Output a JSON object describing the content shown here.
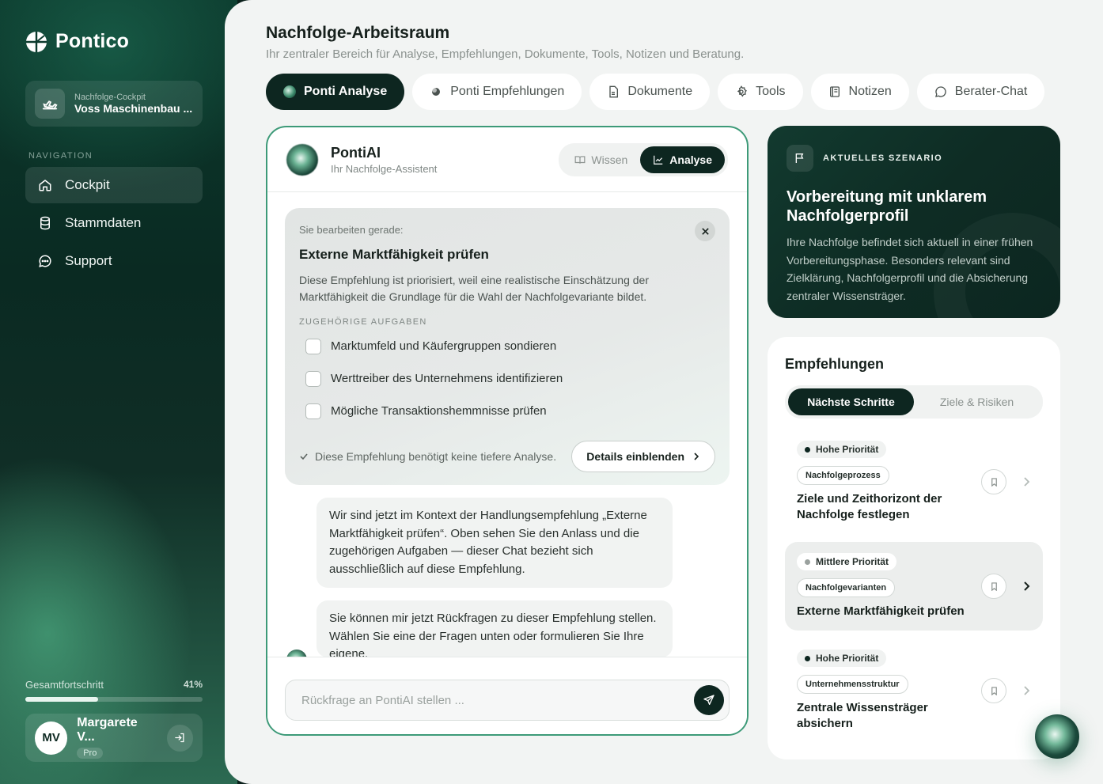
{
  "brand": {
    "name": "Pontico"
  },
  "cockpit": {
    "label": "Nachfolge-Cockpit",
    "company": "Voss Maschinenbau ..."
  },
  "nav": {
    "heading": "NAVIGATION",
    "items": [
      {
        "label": "Cockpit",
        "icon": "home-icon",
        "active": true
      },
      {
        "label": "Stammdaten",
        "icon": "database-icon"
      },
      {
        "label": "Support",
        "icon": "chat-bubble-icon"
      }
    ]
  },
  "progress": {
    "label": "Gesamtfortschritt",
    "value_text": "41%",
    "value": 0.41
  },
  "user": {
    "initials": "MV",
    "name": "Margarete V...",
    "badge": "Pro"
  },
  "header": {
    "title": "Nachfolge-Arbeitsraum",
    "subtitle": "Ihr zentraler Bereich für Analyse, Empfehlungen, Dokumente, Tools, Notizen und Beratung."
  },
  "tabs": [
    {
      "label": "Ponti Analyse",
      "active": true
    },
    {
      "label": "Ponti Empfehlungen"
    },
    {
      "label": "Dokumente"
    },
    {
      "label": "Tools"
    },
    {
      "label": "Notizen"
    },
    {
      "label": "Berater-Chat"
    }
  ],
  "chat": {
    "title": "PontiAI",
    "subtitle": "Ihr Nachfolge-Assistent",
    "mode_knowledge": "Wissen",
    "mode_analysis": "Analyse",
    "editing_label": "Sie bearbeiten gerade:",
    "editing_title": "Externe Marktfähigkeit prüfen",
    "editing_desc": "Diese Empfehlung ist priorisiert, weil eine realistische Einschätzung der Marktfähigkeit die Grundlage für die Wahl der Nachfolgevariante bildet.",
    "tasks_heading": "ZUGEHÖRIGE AUFGABEN",
    "tasks": [
      "Marktumfeld und Käufergruppen sondieren",
      "Werttreiber des Unternehmens identifizieren",
      "Mögliche Transaktionshemmnisse prüfen"
    ],
    "note": "Diese Empfehlung benötigt keine tiefere Analyse.",
    "details_button": "Details einblenden",
    "messages": [
      "Wir sind jetzt im Kontext der Handlungsempfehlung „Externe Marktfähigkeit prüfen“. Oben sehen Sie den Anlass und die zugehörigen Aufgaben — dieser Chat bezieht sich ausschließlich auf diese Empfehlung.",
      "Sie können mir jetzt Rückfragen zu dieser Empfehlung stellen. Wählen Sie eine der Fragen unten oder formulieren Sie Ihre eigene."
    ],
    "input_placeholder": "Rückfrage an PontiAI stellen ..."
  },
  "scenario": {
    "tag": "AKTUELLES SZENARIO",
    "title": "Vorbereitung mit unklarem Nachfolgerprofil",
    "text": "Ihre Nachfolge befindet sich aktuell in einer frühen Vorbereitungsphase. Besonders relevant sind Zielklärung, Nachfolgerprofil und die Absicherung zentraler Wissensträger."
  },
  "recommendations": {
    "title": "Empfehlungen",
    "tab_next": "Nächste Schritte",
    "tab_goals": "Ziele & Risiken",
    "items": [
      {
        "priority": "Hohe Priorität",
        "category": "Nachfolgeprozess",
        "title": "Ziele und Zeithorizont der Nachfolge festlegen"
      },
      {
        "priority": "Mittlere Priorität",
        "category": "Nachfolgevarianten",
        "title": "Externe Marktfähigkeit prüfen"
      },
      {
        "priority": "Hohe Priorität",
        "category": "Unternehmensstruktur",
        "title": "Zentrale Wissensträger absichern"
      }
    ]
  },
  "colors": {
    "primary_dark": "#0d2620",
    "accent_green": "#3d9a78"
  }
}
